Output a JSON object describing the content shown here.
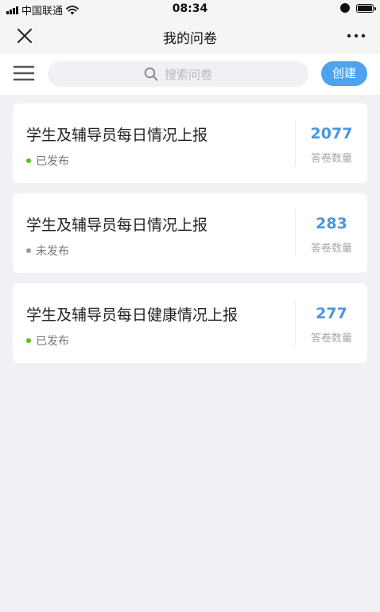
{
  "status_bar": {
    "carrier": "中国联通",
    "time": "08:34"
  },
  "nav": {
    "title": "我的问卷"
  },
  "search": {
    "placeholder": "搜索问卷"
  },
  "toolbar": {
    "create_label": "创建"
  },
  "colors": {
    "accent": "#4da3f0",
    "count": "#4a96e0",
    "published": "#52c41a",
    "unpublished": "#9a9a9a"
  },
  "surveys": [
    {
      "title": "学生及辅导员每日情况上报",
      "status": "已发布",
      "count": "2077",
      "count_label": "答卷数量"
    },
    {
      "title": "学生及辅导员每日情况上报",
      "status": "未发布",
      "count": "283",
      "count_label": "答卷数量"
    },
    {
      "title": "学生及辅导员每日健康情况上报",
      "status": "已发布",
      "count": "277",
      "count_label": "答卷数量"
    }
  ]
}
